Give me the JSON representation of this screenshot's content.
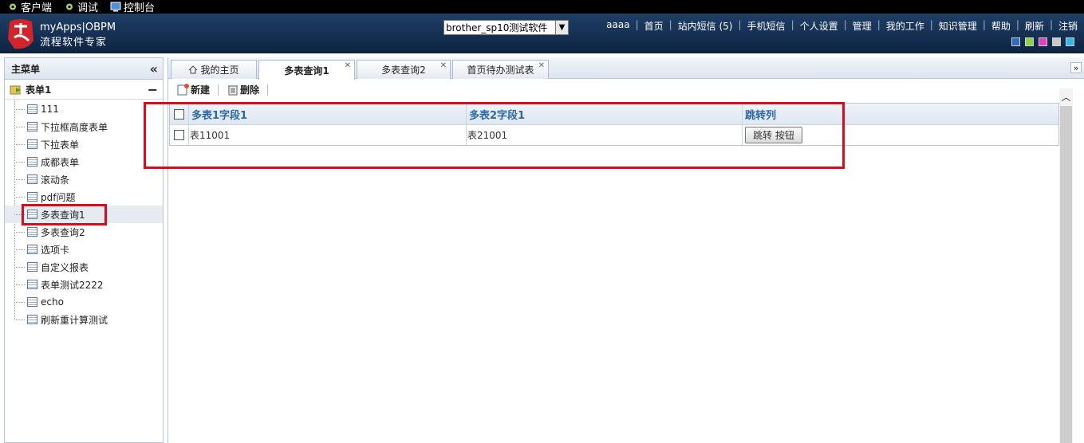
{
  "topbar": {
    "items": [
      {
        "label": "客户端"
      },
      {
        "label": "调试"
      },
      {
        "label": "控制台"
      }
    ]
  },
  "header": {
    "brand_line1": "myApps|OBPM",
    "brand_line2": "流程软件专家",
    "software_select": "brother_sp10测试软件",
    "nav": [
      "aaaa",
      "首页",
      "站内短信 (5)",
      "手机短信",
      "个人设置",
      "管理",
      "我的工作",
      "知识管理",
      "帮助",
      "刷新",
      "注销"
    ],
    "skin_colors": [
      "#2e6fb8",
      "#8fd24a",
      "#e040c0",
      "#c8c8c8",
      "#35b6e8"
    ]
  },
  "sidebar": {
    "title": "主菜单",
    "collapse_icon": "«",
    "group_label": "表单1",
    "group_toggle": "−",
    "items": [
      {
        "label": "111"
      },
      {
        "label": "下拉框高度表单"
      },
      {
        "label": "下拉表单"
      },
      {
        "label": "成都表单"
      },
      {
        "label": "滚动条"
      },
      {
        "label": "pdf问题"
      },
      {
        "label": "多表查询1"
      },
      {
        "label": "多表查询2"
      },
      {
        "label": "选项卡"
      },
      {
        "label": "自定义报表"
      },
      {
        "label": "表单测试2222"
      },
      {
        "label": "echo"
      },
      {
        "label": "刷新重计算测试"
      }
    ],
    "selected_index": 6
  },
  "tabs": [
    {
      "label": "我的主页",
      "closable": false
    },
    {
      "label": "多表查询1",
      "closable": true,
      "active": true
    },
    {
      "label": "多表查询2",
      "closable": true
    },
    {
      "label": "首页待办测试表",
      "closable": true
    }
  ],
  "toolbar": {
    "new_label": "新建",
    "delete_label": "删除"
  },
  "grid": {
    "columns": [
      "多表1字段1",
      "多表2字段1",
      "跳转列"
    ],
    "rows": [
      {
        "col1": "表11001",
        "col2": "表21001",
        "button": "跳转 按钮"
      }
    ]
  },
  "colors": {
    "header_bg": "#16335a",
    "annotation_red": "#d80d1c",
    "grid_header_text": "#2a67a3"
  }
}
